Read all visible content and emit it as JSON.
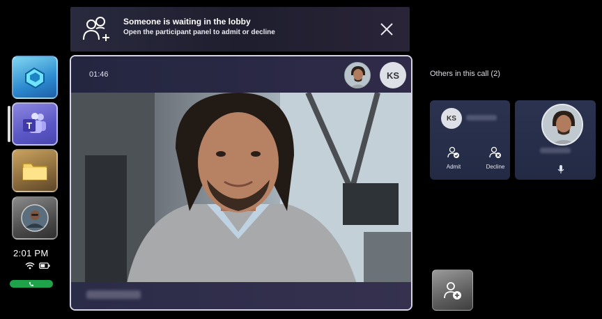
{
  "dock": {
    "time": "2:01 PM",
    "apps": [
      "azure-icon",
      "teams-icon",
      "folder-icon",
      "user-avatar"
    ],
    "accent_call": "#1fa34a"
  },
  "banner": {
    "title": "Someone is waiting in the lobby",
    "subtitle": "Open the participant panel to admit or decline"
  },
  "call": {
    "timer": "01:46",
    "ks_initials": "KS"
  },
  "panel": {
    "others_label": "Others in this call (2)",
    "lobby_initials": "KS",
    "admit_label": "Admit",
    "decline_label": "Decline"
  }
}
